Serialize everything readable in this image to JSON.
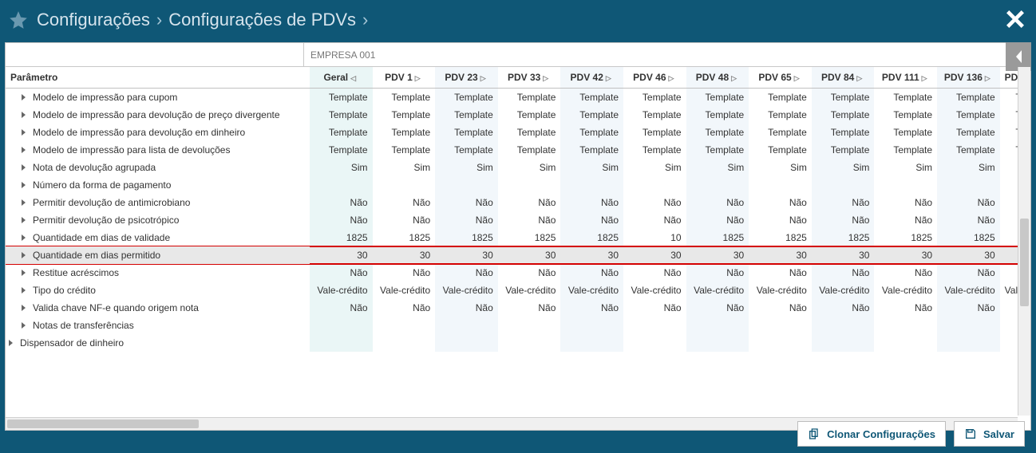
{
  "breadcrumb": {
    "level1": "Configurações",
    "level2": "Configurações de PDVs"
  },
  "filter": {
    "company": "EMPRESA 001"
  },
  "columns": {
    "param": "Parâmetro",
    "geral": "Geral",
    "pdvs": [
      "PDV 1",
      "PDV 23",
      "PDV 33",
      "PDV 42",
      "PDV 46",
      "PDV 48",
      "PDV 65",
      "PDV 84",
      "PDV 111",
      "PDV 136"
    ],
    "overflow": "PDV !"
  },
  "rows": [
    {
      "label": "Modelo de impressão para cupom",
      "level": 1,
      "geral": "Template",
      "vals": [
        "Template",
        "Template",
        "Template",
        "Template",
        "Template",
        "Template",
        "Template",
        "Template",
        "Template",
        "Template"
      ],
      "overflow": "Te"
    },
    {
      "label": "Modelo de impressão para devolução de preço divergente",
      "level": 1,
      "geral": "Template",
      "vals": [
        "Template",
        "Template",
        "Template",
        "Template",
        "Template",
        "Template",
        "Template",
        "Template",
        "Template",
        "Template"
      ],
      "overflow": "Te"
    },
    {
      "label": "Modelo de impressão para devolução em dinheiro",
      "level": 1,
      "geral": "Template",
      "vals": [
        "Template",
        "Template",
        "Template",
        "Template",
        "Template",
        "Template",
        "Template",
        "Template",
        "Template",
        "Template"
      ],
      "overflow": "Te"
    },
    {
      "label": "Modelo de impressão para lista de devoluções",
      "level": 1,
      "geral": "Template",
      "vals": [
        "Template",
        "Template",
        "Template",
        "Template",
        "Template",
        "Template",
        "Template",
        "Template",
        "Template",
        "Template"
      ],
      "overflow": "Te"
    },
    {
      "label": "Nota de devolução agrupada",
      "level": 1,
      "geral": "Sim",
      "vals": [
        "Sim",
        "Sim",
        "Sim",
        "Sim",
        "Sim",
        "Sim",
        "Sim",
        "Sim",
        "Sim",
        "Sim"
      ],
      "overflow": ""
    },
    {
      "label": "Número da forma de pagamento",
      "level": 1,
      "geral": "",
      "vals": [
        "",
        "",
        "",
        "",
        "",
        "",
        "",
        "",
        "",
        ""
      ],
      "overflow": ""
    },
    {
      "label": "Permitir devolução de antimicrobiano",
      "level": 1,
      "geral": "Não",
      "vals": [
        "Não",
        "Não",
        "Não",
        "Não",
        "Não",
        "Não",
        "Não",
        "Não",
        "Não",
        "Não"
      ],
      "overflow": ""
    },
    {
      "label": "Permitir devolução de psicotrópico",
      "level": 1,
      "geral": "Não",
      "vals": [
        "Não",
        "Não",
        "Não",
        "Não",
        "Não",
        "Não",
        "Não",
        "Não",
        "Não",
        "Não"
      ],
      "overflow": ""
    },
    {
      "label": "Quantidade em dias de validade",
      "level": 1,
      "geral": "1825",
      "vals": [
        "1825",
        "1825",
        "1825",
        "1825",
        "10",
        "1825",
        "1825",
        "1825",
        "1825",
        "1825"
      ],
      "overflow": ""
    },
    {
      "label": "Quantidade em dias permitido",
      "level": 1,
      "highlight": true,
      "geral": "30",
      "vals": [
        "30",
        "30",
        "30",
        "30",
        "30",
        "30",
        "30",
        "30",
        "30",
        "30"
      ],
      "overflow": ""
    },
    {
      "label": "Restitue acréscimos",
      "level": 1,
      "geral": "Não",
      "vals": [
        "Não",
        "Não",
        "Não",
        "Não",
        "Não",
        "Não",
        "Não",
        "Não",
        "Não",
        "Não"
      ],
      "overflow": ""
    },
    {
      "label": "Tipo do crédito",
      "level": 1,
      "geral": "Vale-crédito",
      "vals": [
        "Vale-crédito",
        "Vale-crédito",
        "Vale-crédito",
        "Vale-crédito",
        "Vale-crédito",
        "Vale-crédito",
        "Vale-crédito",
        "Vale-crédito",
        "Vale-crédito",
        "Vale-crédito"
      ],
      "overflow": "Vale-"
    },
    {
      "label": "Valida chave NF-e quando origem nota",
      "level": 1,
      "geral": "Não",
      "vals": [
        "Não",
        "Não",
        "Não",
        "Não",
        "Não",
        "Não",
        "Não",
        "Não",
        "Não",
        "Não"
      ],
      "overflow": ""
    },
    {
      "label": "Notas de transferências",
      "level": 1,
      "geral": "",
      "vals": [
        "",
        "",
        "",
        "",
        "",
        "",
        "",
        "",
        "",
        ""
      ],
      "overflow": ""
    },
    {
      "label": "Dispensador de dinheiro",
      "level": 0,
      "geral": "",
      "vals": [
        "",
        "",
        "",
        "",
        "",
        "",
        "",
        "",
        "",
        ""
      ],
      "overflow": ""
    }
  ],
  "footer": {
    "clone": "Clonar Configurações",
    "save": "Salvar"
  }
}
